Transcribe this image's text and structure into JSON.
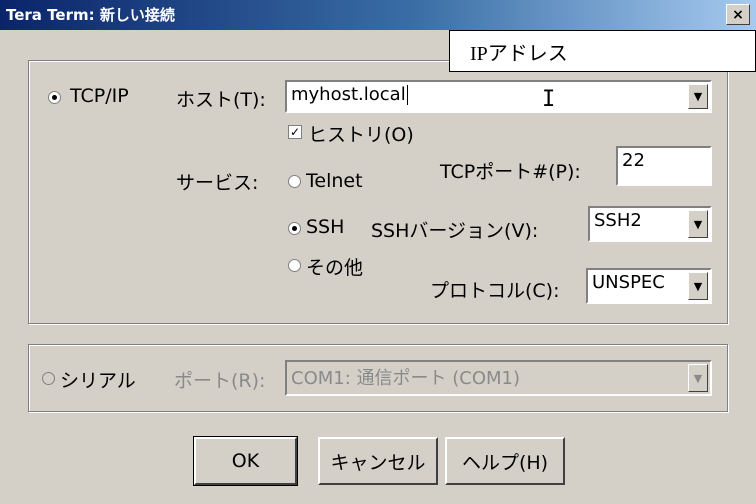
{
  "window": {
    "title": "Tera Term: 新しい接続",
    "close_label": "×"
  },
  "tooltip": {
    "text": "IPアドレス"
  },
  "tcpip": {
    "radio_label": "TCP/IP",
    "host_label": "ホスト(T):",
    "host_value": "myhost.local",
    "history_label": "ヒストリ(O)",
    "history_checked": true,
    "service_label": "サービス:",
    "telnet_label": "Telnet",
    "ssh_label": "SSH",
    "other_label": "その他",
    "port_label": "TCPポート#(P):",
    "port_value": "22",
    "ssh_version_label": "SSHバージョン(V):",
    "ssh_version_value": "SSH2",
    "protocol_label": "プロトコル(C):",
    "protocol_value": "UNSPEC"
  },
  "serial": {
    "radio_label": "シリアル",
    "port_label": "ポート(R):",
    "port_value": "COM1: 通信ポート (COM1)"
  },
  "buttons": {
    "ok": "OK",
    "cancel": "キャンセル",
    "help": "ヘルプ(H)"
  },
  "icons": {
    "checkmark": "✓",
    "dropdown": "▼"
  }
}
